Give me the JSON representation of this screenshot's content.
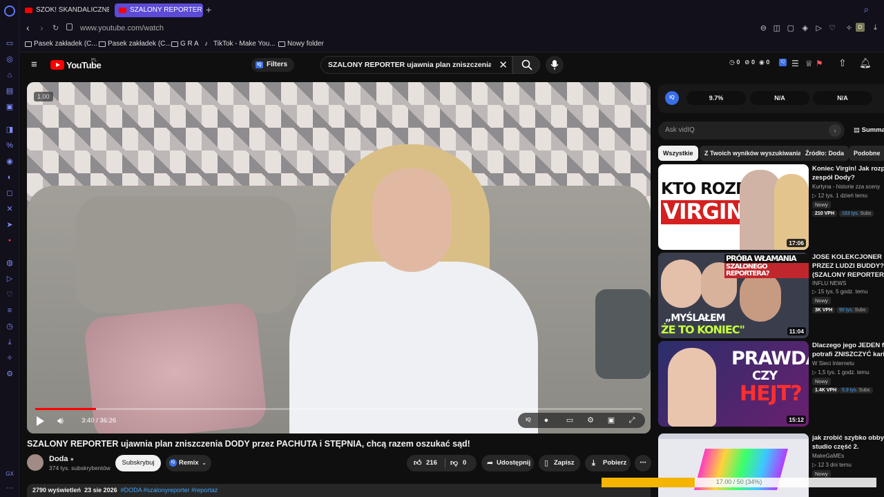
{
  "browser": {
    "tabs": [
      {
        "label": "SZOK! SKANDALICZNE ZACHOWANIE"
      },
      {
        "label": "SZALONY REPORTER ujawnia plan"
      }
    ],
    "url": "www.youtube.com/watch",
    "bookmarks": [
      "Pasek zakładek (C...",
      "Pasek zakładek (C...",
      "G R A",
      "TikTok - Make You...",
      "Nowy folder"
    ]
  },
  "header": {
    "logo_text": "YouTube",
    "region": "PL",
    "filters_label": "Filters",
    "search_value": "SZALONY REPORTER ujawnia plan zniszczenia DODY",
    "counters": [
      "0",
      "0",
      "0"
    ]
  },
  "player": {
    "speed": "1.00",
    "time": "3:40 / 36:26",
    "progress": 0.1
  },
  "video": {
    "title": "SZALONY REPORTER ujawnia plan zniszczenia DODY przez PACHUTA i STĘPNIA, chcą razem oszukać sąd!",
    "channel": "Doda",
    "subscribers": "374 tys. subskrybentów",
    "subscribe_label": "Subskrybuj",
    "remix_label": "Remix",
    "likes": "216",
    "dislikes": "0",
    "share_label": "Udostępnij",
    "save_label": "Zapisz",
    "download_label": "Pobierz",
    "views": "2790 wyświetleń",
    "date": "23 sie 2026",
    "hashtags": "#DODA #szalonyreporter #reportaż"
  },
  "vidiq": {
    "logo": "IQ",
    "stats": [
      "9.7%",
      "N/A",
      "N/A"
    ],
    "ask_placeholder": "Ask vidIQ",
    "summary_label": "Summa"
  },
  "chips": [
    "Wszystkie",
    "Z Twoich wyników wyszukiwania",
    "Źródło: Doda",
    "Podobne"
  ],
  "recommendations": [
    {
      "title_lines": [
        "Koniec Virgin! Jak rozpadł",
        "zespół Dody?"
      ],
      "channel": "Kurtyna - historie zza sceny",
      "meta": "12 tys.   1 dzień temu",
      "badge": "Nowy",
      "vph": "210 VPH",
      "subs": "163 tys.",
      "subs_suffix": "Subs",
      "duration": "17:06",
      "thumb_text": [
        "KTO ROZBIŁ",
        "VIRGIN?"
      ]
    },
    {
      "title_lines": [
        "JOSE KOLEKCJONER POBI",
        "PRZEZ LUDZI BUDDY?!",
        "(SZALONY REPORTER, DIO"
      ],
      "channel": "INFLU NEWS",
      "meta": "15 tys.   5 godz. temu",
      "badge": "Nowy",
      "vph": "3K VPH",
      "subs": "90 tys.",
      "subs_suffix": "Subs",
      "duration": "11:04",
      "thumb_text": [
        "PRÓBA WŁAMANIA DO",
        "SZALONEGO REPORTERA?",
        "„MYŚLAŁEM",
        "ŻE TO KONIEC\""
      ]
    },
    {
      "title_lines": [
        "Dlaczego jego JEDEN film",
        "potrafi ZNISZCZYĆ karierę"
      ],
      "channel": "W Sieci Internetu",
      "meta": "1,5 tys.   1 godz. temu",
      "badge": "Nowy",
      "vph": "1.4K VPH",
      "subs": "5.9 tys.",
      "subs_suffix": "Subs",
      "duration": "15:12",
      "thumb_text": [
        "PRAWDA",
        "CZY",
        "HEJT?"
      ]
    },
    {
      "title_lines": [
        "jak zrobić szybko obby w r",
        "studio część 2."
      ],
      "channel": "MakeGaMEs",
      "meta": "12   3 dni temu",
      "badge": "Nowy",
      "vph": "",
      "subs": "",
      "subs_suffix": "",
      "duration": "",
      "thumb_text": []
    }
  ],
  "overlay": {
    "text": "17.00 / 50 (34%)",
    "progress": 0.34
  },
  "colors": {
    "accent": "#ff0000",
    "link": "#3ea6ff",
    "vidiq": "#3a6ee8",
    "opera": "#5b4bd6"
  }
}
